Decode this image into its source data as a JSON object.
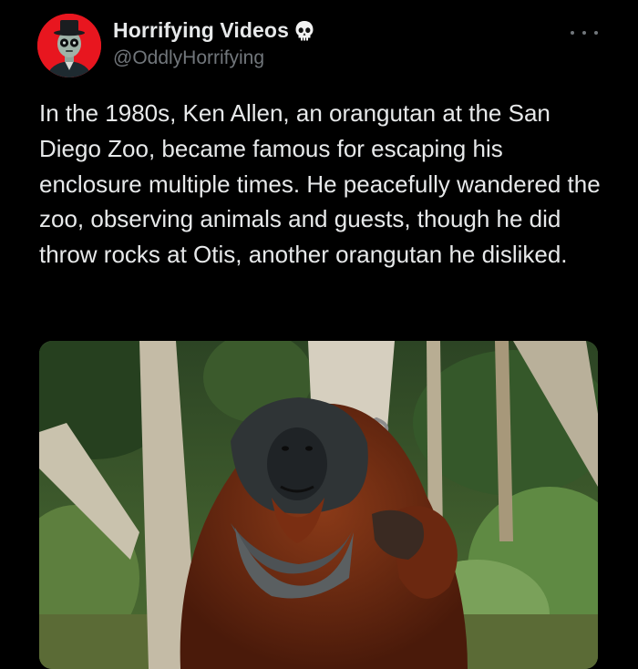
{
  "author": {
    "display_name": "Horrifying Videos",
    "handle": "@OddlyHorrifying",
    "badge_icon": "skull-icon",
    "avatar_bg": "#e8161f"
  },
  "tweet": {
    "text": "In the 1980s, Ken Allen, an orangutan at the San Diego Zoo, became famous for escaping his enclosure multiple times. He peacefully wandered the zoo, observing animals and guests, though he did throw rocks at Otis, another orangutan he disliked.",
    "more_icon": "more-horizontal-icon"
  },
  "media": {
    "icon": "photo",
    "subject_colors": {
      "fur": "#6e2a12",
      "face": "#2d3133",
      "foliage": "#3f6b2c"
    }
  },
  "colors": {
    "background": "#000000",
    "primary_text": "#e7e9ea",
    "secondary_text": "#71767b"
  }
}
